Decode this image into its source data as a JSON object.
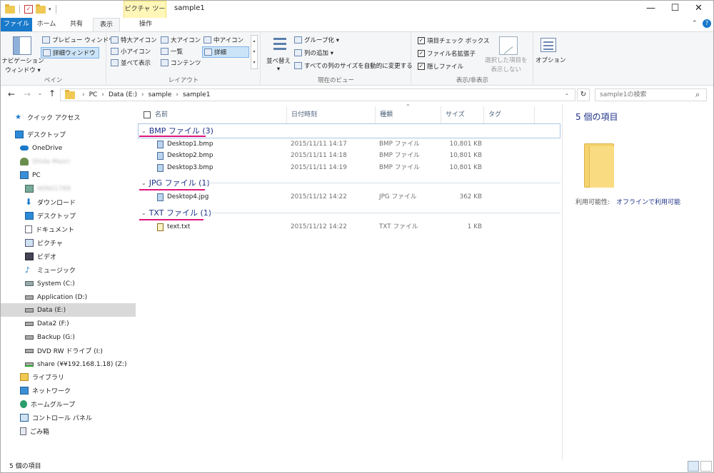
{
  "window": {
    "context_tab": "ピクチャ ツール",
    "title": "sample1"
  },
  "tabs": {
    "file": "ファイル",
    "home": "ホーム",
    "share": "共有",
    "view": "表示",
    "manage": "操作"
  },
  "ribbon": {
    "pane": {
      "nav_pane_line1": "ナビゲーション",
      "nav_pane_line2": "ウィンドウ ▾",
      "preview": "プレビュー ウィンドウ",
      "details": "詳細ウィンドウ",
      "label": "ペイン"
    },
    "layout": {
      "extra_large": "特大アイコン",
      "large": "大アイコン",
      "medium": "中アイコン",
      "small": "小アイコン",
      "list": "一覧",
      "details": "詳細",
      "tiles": "並べて表示",
      "content": "コンテンツ",
      "label": "レイアウト"
    },
    "current_view": {
      "sort_by": "並べ替え",
      "group_by": "グループ化 ▾",
      "add_columns": "列の追加 ▾",
      "size_all": "すべての列のサイズを自動的に変更する",
      "label": "現在のビュー"
    },
    "show_hide": {
      "item_checkboxes": "項目チェック ボックス",
      "file_extensions": "ファイル名拡張子",
      "hidden_items": "隠しファイル",
      "hide_selected_line1": "選択した項目を",
      "hide_selected_line2": "表示しない",
      "label": "表示/非表示"
    },
    "options": "オプション"
  },
  "address": {
    "crumbs": [
      "PC",
      "Data (E:)",
      "sample",
      "sample1"
    ],
    "search_placeholder": "sample1の検索"
  },
  "nav": {
    "quick_access": "クイック アクセス",
    "desktop_top": "デスクトップ",
    "onedrive": "OneDrive",
    "user": "Shida Maori",
    "pc": "PC",
    "network_device": "WIN01789",
    "downloads": "ダウンロード",
    "desktop": "デスクトップ",
    "documents": "ドキュメント",
    "pictures": "ピクチャ",
    "videos": "ビデオ",
    "music": "ミュージック",
    "system_c": "System (C:)",
    "application_d": "Application (D:)",
    "data_e": "Data (E:)",
    "data2_f": "Data2 (F:)",
    "backup_g": "Backup (G:)",
    "dvd": "DVD RW ドライブ (I:)",
    "share": "share (¥¥192.168.1.18) (Z:)",
    "libraries": "ライブラリ",
    "network": "ネットワーク",
    "homegroup": "ホームグループ",
    "control_panel": "コントロール パネル",
    "recycle_bin": "ごみ箱"
  },
  "columns": {
    "name": "名前",
    "date": "日付時刻",
    "type": "種類",
    "size": "サイズ",
    "tags": "タグ"
  },
  "groups": [
    {
      "header": "BMP ファイル (3)",
      "files": [
        {
          "name": "Desktop1.bmp",
          "date": "2015/11/11 14:17",
          "type": "BMP ファイル",
          "size": "10,801 KB"
        },
        {
          "name": "Desktop2.bmp",
          "date": "2015/11/11 14:18",
          "type": "BMP ファイル",
          "size": "10,801 KB"
        },
        {
          "name": "Desktop3.bmp",
          "date": "2015/11/11 14:19",
          "type": "BMP ファイル",
          "size": "10,801 KB"
        }
      ]
    },
    {
      "header": "JPG ファイル (1)",
      "files": [
        {
          "name": "Desktop4.jpg",
          "date": "2015/11/12 14:22",
          "type": "JPG ファイル",
          "size": "362 KB"
        }
      ]
    },
    {
      "header": "TXT ファイル (1)",
      "files": [
        {
          "name": "text.txt",
          "date": "2015/11/12 14:22",
          "type": "TXT ファイル",
          "size": "1 KB"
        }
      ]
    }
  ],
  "details_pane": {
    "count": "5 個の項目",
    "availability_label": "利用可能性:",
    "availability_value": "オフラインで利用可能"
  },
  "status": {
    "count": "5 個の項目"
  },
  "colors": {
    "file_tab": "#1979ca",
    "group_header": "#1e3287",
    "highlight_underline": "#e0147a",
    "folder": "#f0c954"
  }
}
